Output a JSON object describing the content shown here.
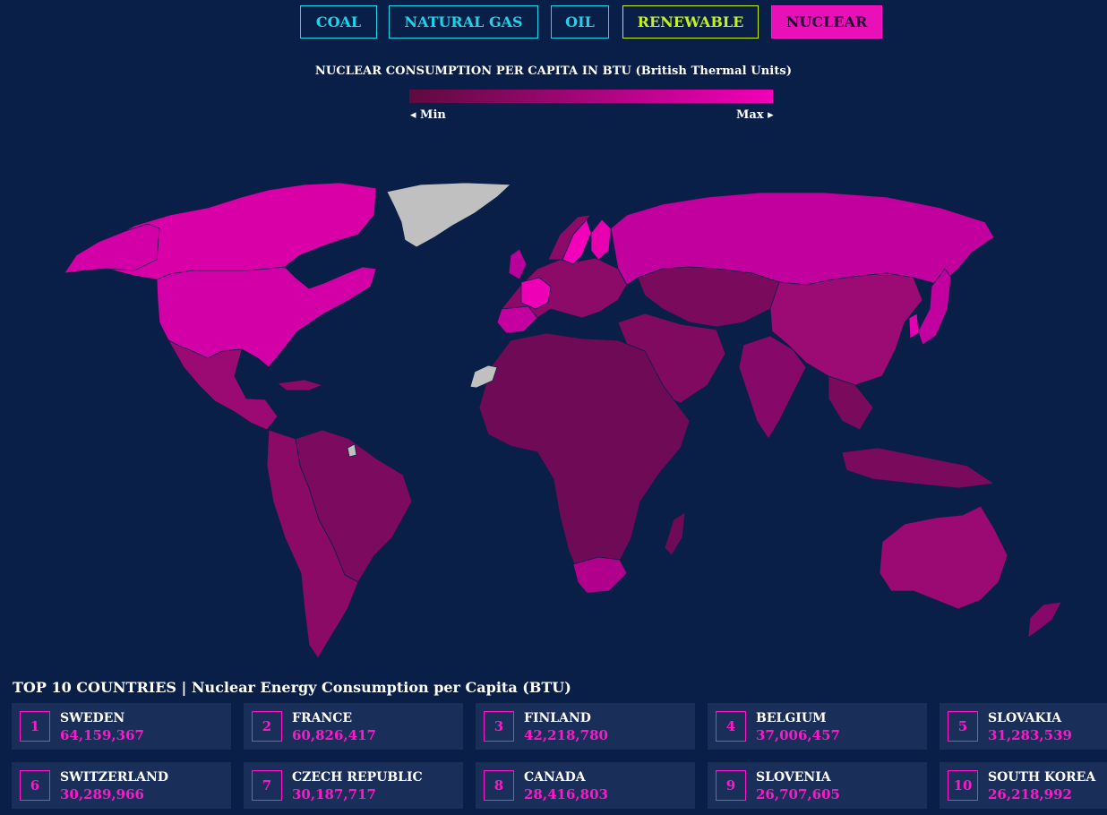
{
  "tabs": [
    {
      "label": "COAL",
      "color": "#19d6ea"
    },
    {
      "label": "NATURAL GAS",
      "color": "#19d6ea"
    },
    {
      "label": "OIL",
      "color": "#19d6ea"
    },
    {
      "label": "RENEWABLE",
      "color": "#c6f21c"
    },
    {
      "label": "NUCLEAR",
      "color": "#ff17c9",
      "active": true
    }
  ],
  "legend": {
    "title": "NUCLEAR CONSUMPTION PER CAPITA IN BTU (British Thermal Units)",
    "min_label": "◂ Min",
    "max_label": "Max ▸",
    "min_color": "#5e0b3f",
    "max_color": "#f200b8"
  },
  "top10": {
    "title": "TOP 10 COUNTRIES | Nuclear Energy Consumption per Capita (BTU)",
    "items": [
      {
        "rank": "1",
        "country": "SWEDEN",
        "value": "64,159,367"
      },
      {
        "rank": "2",
        "country": "FRANCE",
        "value": "60,826,417"
      },
      {
        "rank": "3",
        "country": "FINLAND",
        "value": "42,218,780"
      },
      {
        "rank": "4",
        "country": "BELGIUM",
        "value": "37,006,457"
      },
      {
        "rank": "5",
        "country": "SLOVAKIA",
        "value": "31,283,539"
      },
      {
        "rank": "6",
        "country": "SWITZERLAND",
        "value": "30,289,966"
      },
      {
        "rank": "7",
        "country": "CZECH REPUBLIC",
        "value": "30,187,717"
      },
      {
        "rank": "8",
        "country": "CANADA",
        "value": "28,416,803"
      },
      {
        "rank": "9",
        "country": "SLOVENIA",
        "value": "26,707,605"
      },
      {
        "rank": "10",
        "country": "SOUTH KOREA",
        "value": "26,218,992"
      }
    ]
  },
  "colors": {
    "background": "#0a1f47",
    "card": "#1a2e5a",
    "accent": "#ff17c9",
    "no_data": "#c0c0c0"
  }
}
